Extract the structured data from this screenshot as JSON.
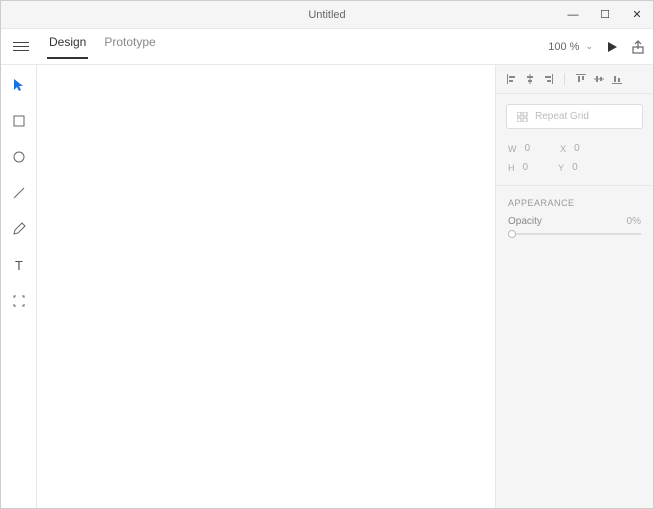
{
  "title": "Untitled",
  "tabs": {
    "design": "Design",
    "prototype": "Prototype"
  },
  "zoom": "100 %",
  "repeat_label": "Repeat Grid",
  "dims": {
    "w_label": "W",
    "w_val": "0",
    "x_label": "X",
    "x_val": "0",
    "h_label": "H",
    "h_val": "0",
    "y_label": "Y",
    "y_val": "0"
  },
  "appearance": {
    "header": "APPEARANCE",
    "opacity_label": "Opacity",
    "opacity_val": "0%"
  }
}
